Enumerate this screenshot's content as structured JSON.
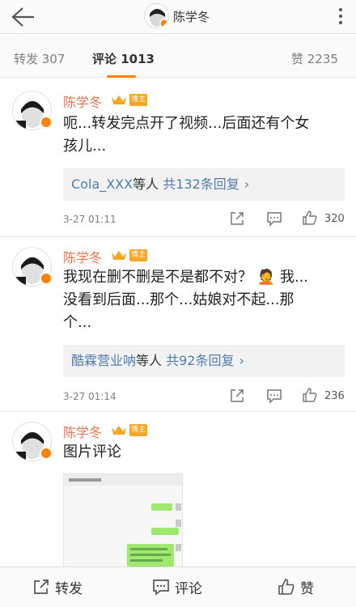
{
  "header": {
    "author_name": "陈学冬"
  },
  "tabs": {
    "repost": "转发 307",
    "comments": "评论 1013",
    "likes": "赞 2235"
  },
  "comments": [
    {
      "author": "陈学冬",
      "level_badge": "博主",
      "text_line1": "呃...转发完点开了视频...后面还有个女",
      "text_line2": "孩儿...",
      "reply_user": "Cola_XXX",
      "reply_others": "等人",
      "reply_count": "共132条回复",
      "time": "3-27 01:11",
      "likes": "320"
    },
    {
      "author": "陈学冬",
      "level_badge": "博主",
      "text_line1": "我现在删不删是不是都不对？ 🤦 我...",
      "text_line2": "没看到后面...那个...姑娘对不起...那",
      "text_line3": "个...",
      "reply_user": "酷霖营业呐",
      "reply_others": "等人",
      "reply_count": "共92条回复",
      "time": "3-27 01:14",
      "likes": "236"
    },
    {
      "author": "陈学冬",
      "level_badge": "博主",
      "text_line1": "图片评论"
    }
  ],
  "bottom_bar": {
    "repost": "转发",
    "comment": "评论",
    "like": "赞"
  },
  "colors": {
    "accent": "#ff8200",
    "author": "#eb7350",
    "link": "#507daf"
  }
}
